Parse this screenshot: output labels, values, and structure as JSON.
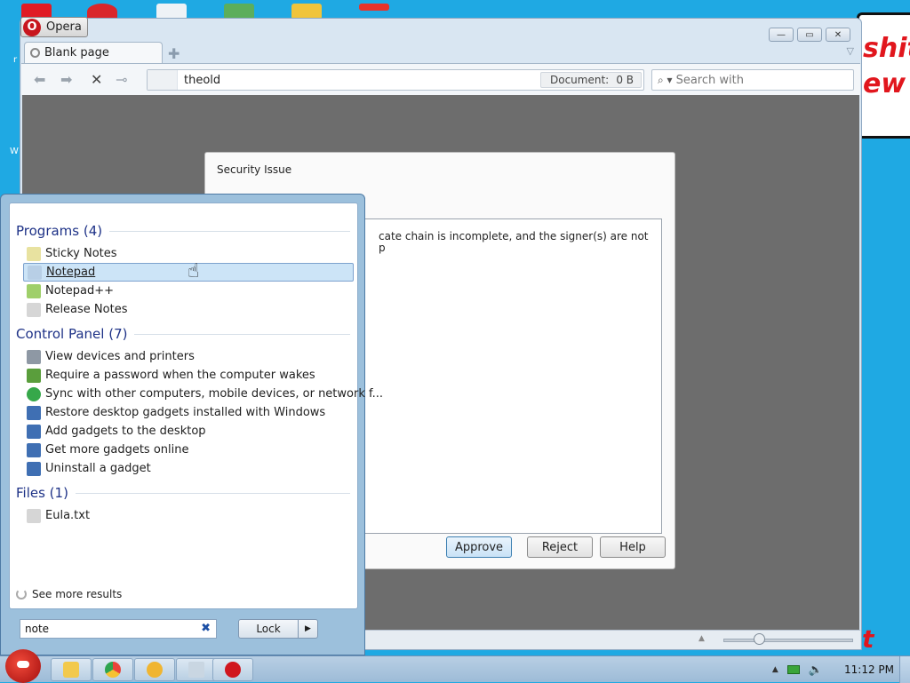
{
  "desktop": {
    "banner_line1": "shit",
    "banner_line2": "ew",
    "edge_glyph": "t",
    "edge_letter_1": "r",
    "edge_letter_2": "W"
  },
  "opera": {
    "menu_label": "Opera",
    "logo_glyph": "O",
    "tab_title": "Blank page",
    "address_value": "theold",
    "document_label": "Document:",
    "document_size": "0 B",
    "search_placeholder": "Search with",
    "icons": {
      "back": "back-arrow-icon",
      "forward": "forward-arrow-icon",
      "stop": "stop-icon",
      "key": "key-icon",
      "new_tab": "plus-icon",
      "tab_menu": "chevron-down-icon",
      "minimize": "minimize-icon",
      "maximize": "restore-icon",
      "close": "close-icon"
    }
  },
  "dialog": {
    "title": "Security Issue",
    "message": "cate chain is incomplete, and the signer(s) are not",
    "message_tail": "p",
    "buttons": {
      "approve": "Approve",
      "reject": "Reject",
      "help": "Help"
    }
  },
  "start_menu": {
    "sections": [
      {
        "heading": "Programs (4)",
        "items": [
          {
            "label": "Sticky Notes",
            "icon": "sticky-notes-icon",
            "color": "#e8e2a0"
          },
          {
            "label": "Notepad",
            "icon": "notepad-icon",
            "color": "#b8cfe6",
            "selected": true
          },
          {
            "label": "Notepad++",
            "icon": "notepad-plus-plus-icon",
            "color": "#9fcf6a"
          },
          {
            "label": "Release Notes",
            "icon": "document-icon",
            "color": "#d6d6d6"
          }
        ]
      },
      {
        "heading": "Control Panel (7)",
        "items": [
          {
            "label": "View devices and printers",
            "icon": "printer-icon",
            "color": "#8e98a4"
          },
          {
            "label": "Require a password when the computer wakes",
            "icon": "power-options-icon",
            "color": "#5a9e3c"
          },
          {
            "label": "Sync with other computers, mobile devices, or network f...",
            "icon": "sync-icon",
            "color": "#36a84a"
          },
          {
            "label": "Restore desktop gadgets installed with Windows",
            "icon": "gadgets-icon",
            "color": "#3f6fb3"
          },
          {
            "label": "Add gadgets to the desktop",
            "icon": "gadgets-icon",
            "color": "#3f6fb3"
          },
          {
            "label": "Get more gadgets online",
            "icon": "gadgets-icon",
            "color": "#3f6fb3"
          },
          {
            "label": "Uninstall a gadget",
            "icon": "gadgets-icon",
            "color": "#3f6fb3"
          }
        ]
      },
      {
        "heading": "Files (1)",
        "items": [
          {
            "label": "Eula.txt",
            "icon": "text-file-icon",
            "color": "#d6d6d6"
          }
        ]
      }
    ],
    "see_more": "See more results",
    "search_value": "note",
    "clear_glyph": "✖",
    "lock_label": "Lock"
  },
  "taskbar": {
    "clock": "11:12 PM",
    "apps": [
      {
        "name": "explorer-icon",
        "color": "#f2c94c"
      },
      {
        "name": "chrome-icon",
        "color": "#e9443a"
      },
      {
        "name": "gear-app-icon",
        "color": "#f0b531"
      },
      {
        "name": "notepad-app-icon",
        "color": "#c9d6e2"
      },
      {
        "name": "opera-app-icon",
        "color": "#d0161e"
      }
    ]
  },
  "colors": {
    "desktop_bg": "#1fa9e3",
    "accent_red": "#e1161d",
    "selection": "#cce4f7",
    "section_heading": "#1e3287"
  }
}
